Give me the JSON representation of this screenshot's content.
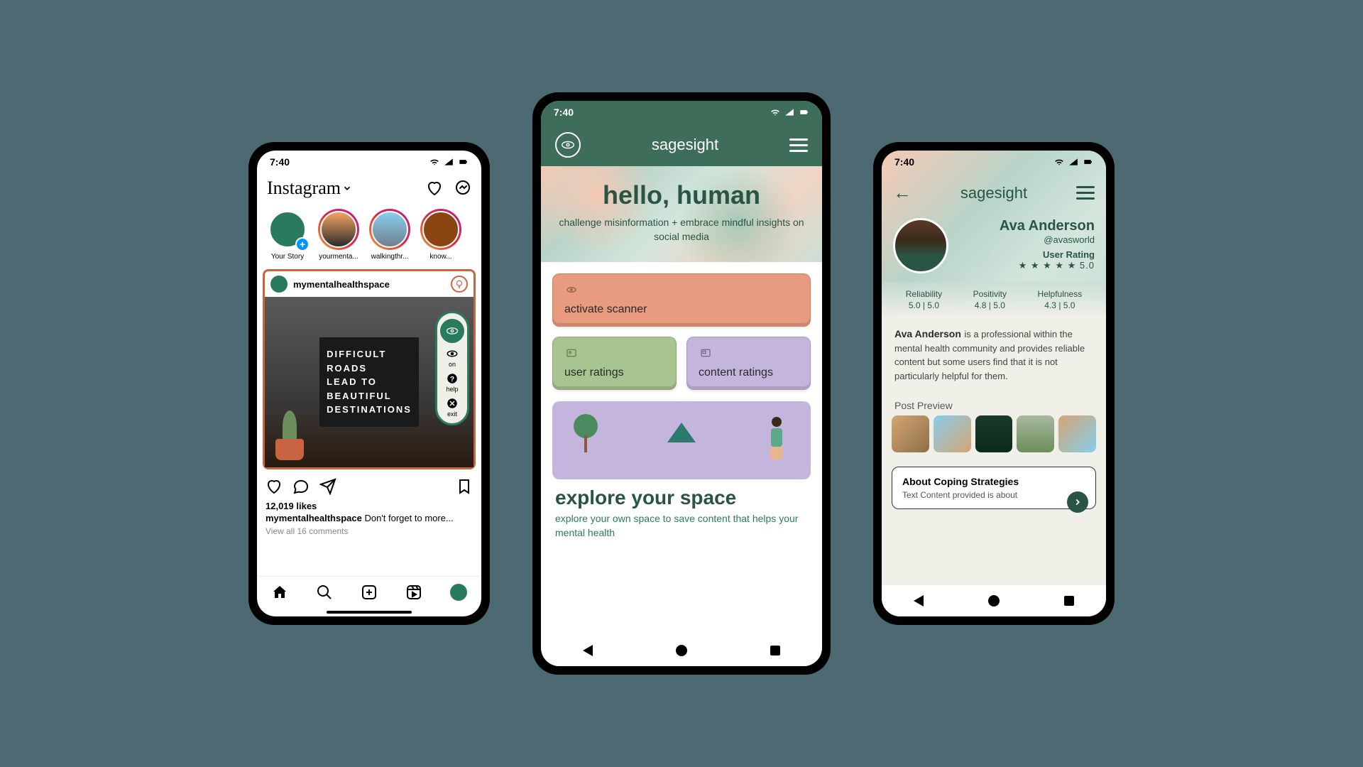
{
  "phone1": {
    "time": "7:40",
    "logo": "Instagram",
    "stories": [
      {
        "label": "Your Story",
        "own": true
      },
      {
        "label": "yourmenta..."
      },
      {
        "label": "walkingthr..."
      },
      {
        "label": "know..."
      }
    ],
    "post": {
      "username": "mymentalhealthspace",
      "board_lines": [
        "DIFFICULT",
        "ROADS",
        "LEAD TO",
        "BEAUTIFUL",
        "DESTINATIONS"
      ],
      "likes": "12,019 likes",
      "caption_user": "mymentalhealthspace",
      "caption_text": " Don't forget to more...",
      "comments": "View all 16 comments"
    },
    "pill": {
      "on": "on",
      "help": "help",
      "exit": "exit"
    }
  },
  "phone2": {
    "time": "7:40",
    "brand": "sagesight",
    "hero_title": "hello, human",
    "hero_sub": "challenge misinformation + embrace mindful insights on social media",
    "cards": {
      "scanner": "activate scanner",
      "user_ratings": "user ratings",
      "content_ratings": "content ratings"
    },
    "explore_title": "explore your space",
    "explore_sub": "explore your own space to save content that helps your mental health"
  },
  "phone3": {
    "time": "7:40",
    "brand": "sagesight",
    "profile": {
      "name": "Ava Anderson",
      "handle": "@avasworld",
      "rating_label": "User Rating",
      "rating_value": "5.0",
      "stars": "★ ★ ★ ★ ★"
    },
    "metrics": [
      {
        "label": "Reliability",
        "value": "5.0 | 5.0"
      },
      {
        "label": "Positivity",
        "value": "4.8 | 5.0"
      },
      {
        "label": "Helpfulness",
        "value": "4.3 | 5.0"
      }
    ],
    "bio_name": "Ava Anderson",
    "bio_text": "is a professional within the mental health community and provides reliable content but some users find that it is not particularly helpful for them.",
    "preview_label": "Post Preview",
    "about_title": "About Coping Strategies",
    "about_text": "Text Content provided is about"
  }
}
